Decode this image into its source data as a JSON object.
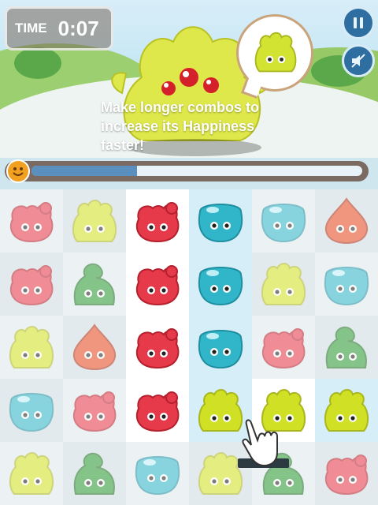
{
  "hud": {
    "time_label": "TIME",
    "time_value": "0:07",
    "pause_icon": "pause-icon",
    "mute_icon": "sound-muted-icon"
  },
  "tutorial": {
    "line1": "Make longer combos to",
    "line2": "increase its Happiness",
    "line3": "faster!"
  },
  "happiness": {
    "progress": 0.32,
    "face_icon": "smiley-face-icon"
  },
  "colors": {
    "red": "#e63a4a",
    "teal": "#31b6c9",
    "yellow": "#cfe025",
    "green": "#2e9a35",
    "orange": "#e64a24"
  },
  "board": {
    "cols": 6,
    "rows": 5,
    "grid": [
      [
        "red-bear",
        "yellow-spiky",
        "red-bear",
        "teal-blob",
        "teal-blob",
        "orange-drop"
      ],
      [
        "red-bear",
        "green-curl",
        "red-bear",
        "teal-blob",
        "yellow-spiky",
        "teal-blob"
      ],
      [
        "yellow-spiky",
        "orange-drop",
        "red-bear",
        "teal-blob",
        "red-bear",
        "green-curl"
      ],
      [
        "teal-blob",
        "red-bear",
        "red-bear",
        "yellow-spiky",
        "yellow-spiky",
        "yellow-spiky"
      ],
      [
        "yellow-spiky",
        "green-curl",
        "teal-blob",
        "yellow-spiky",
        "green-curl",
        "red-bear"
      ]
    ],
    "highlighted": [
      [
        0,
        2
      ],
      [
        0,
        3
      ],
      [
        1,
        2
      ],
      [
        1,
        3
      ],
      [
        2,
        2
      ],
      [
        2,
        3
      ],
      [
        3,
        2
      ],
      [
        3,
        3
      ],
      [
        3,
        4
      ],
      [
        3,
        5
      ]
    ]
  }
}
